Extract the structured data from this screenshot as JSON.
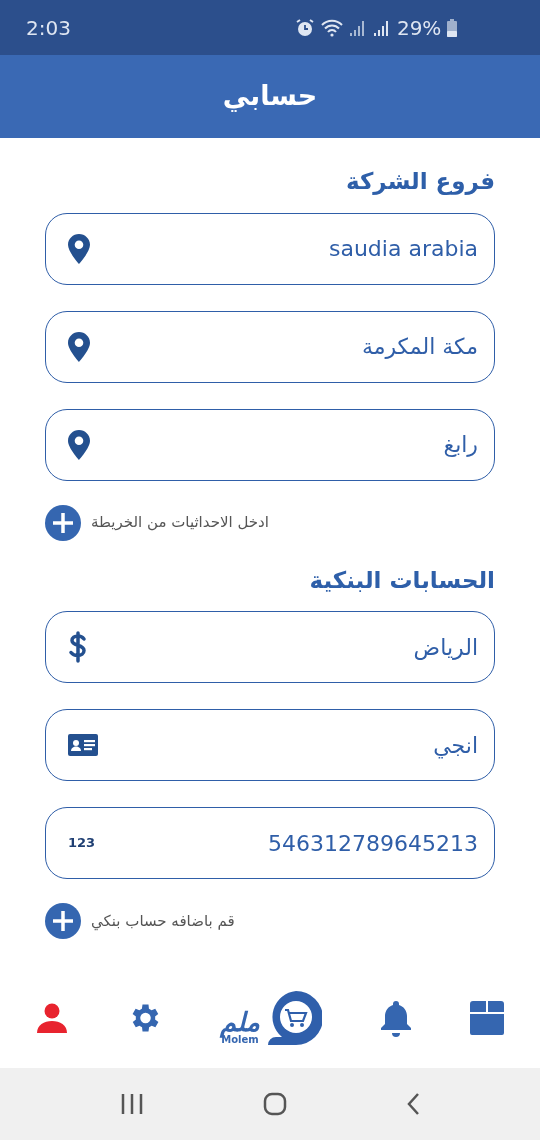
{
  "status_bar": {
    "time": "2:03",
    "battery": "29%"
  },
  "header": {
    "title": "حسابي"
  },
  "sections": [
    {
      "title": "فروع الشركة",
      "fields": [
        {
          "value": "saudia arabia",
          "kind": "pin"
        },
        {
          "value": "مكة المكرمة",
          "kind": "pin"
        },
        {
          "value": "رابغ",
          "kind": "pin"
        }
      ],
      "add_label": "ادخل الاحداثيات من الخريطة"
    },
    {
      "title": "الحسابات البنكية",
      "fields": [
        {
          "value": "الرياض",
          "kind": "dollar"
        },
        {
          "value": "انجي",
          "kind": "card"
        },
        {
          "value": "546312789645213",
          "kind": "digits",
          "icon_text": "123"
        }
      ],
      "add_label": "قم باضافه حساب بنكي"
    }
  ],
  "bottom_nav": [
    {
      "kind": "person",
      "selected": true
    },
    {
      "kind": "gear",
      "selected": false
    },
    {
      "kind": "logo",
      "logo_arabic": "ملم",
      "logo_latin": "Molem",
      "selected": false
    },
    {
      "kind": "bell",
      "selected": false
    },
    {
      "kind": "box",
      "selected": false
    }
  ]
}
